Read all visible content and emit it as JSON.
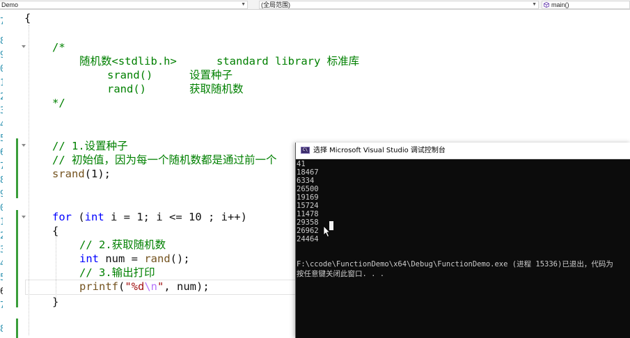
{
  "navbar": {
    "project": "Demo",
    "scope": "(全局范围)",
    "function": "main()"
  },
  "gutter": {
    "line_numbers": [
      "7",
      "8",
      "9",
      "0",
      "1",
      "2",
      "3",
      "4",
      "5",
      "6",
      "7",
      "8",
      "9",
      "0",
      "1",
      "2",
      "3",
      "4",
      "5",
      "6",
      "7",
      "8"
    ],
    "current_index": 19
  },
  "code": {
    "brace_open": "{",
    "comment_start": "/*",
    "comment_l1_a": "随机数<stdlib.h>",
    "comment_l1_b": "standard library 标准库",
    "comment_l2_a": "srand()",
    "comment_l2_b": "设置种子",
    "comment_l3_a": "rand()",
    "comment_l3_b": "获取随机数",
    "comment_end": "*/",
    "c_step1": "// 1.设置种子",
    "c_init": "// 初始值，因为每一个随机数都是通过前一个",
    "srand_fn": "srand",
    "srand_args": "(1);",
    "kw_for": "for",
    "for_a": " (",
    "kw_int": "int",
    "for_b": " i = 1; i <= 10 ; i++)",
    "brace_inner_open": "{",
    "c_step2": "// 2.获取随机数",
    "kw_int2": "int",
    "num_decl": " num = ",
    "rand_fn": "rand",
    "rand_args": "();",
    "c_step3": "// 3.输出打印",
    "printf_fn": "printf",
    "paren_open": "(",
    "str_a": "\"%d",
    "str_esc": "\\n",
    "str_b": "\"",
    "printf_rest": ", num);",
    "brace_inner_close": "}"
  },
  "console": {
    "title": "选择 Microsoft Visual Studio 调试控制台",
    "icon_label": "C\\",
    "output": [
      "41",
      "18467",
      "6334",
      "26500",
      "19169",
      "15724",
      "11478",
      "29358",
      "26962",
      "24464"
    ],
    "exit_msg": "F:\\ccode\\FunctionDemo\\x64\\Debug\\FunctionDemo.exe (进程 15336)已退出，代码为",
    "close_msg": "按任意键关闭此窗口. . ."
  },
  "colors": {
    "comment": "#008000",
    "keyword": "#0000ff",
    "function": "#74531f",
    "string": "#a31515",
    "escape": "#b776fb",
    "line_number": "#2b91af",
    "change_bar": "#3a9d3a",
    "console_bg": "#0c0c0c"
  },
  "icons": [
    "dropdown-arrow-icon",
    "cube-icon",
    "fold-collapse-icon",
    "console-app-icon",
    "mouse-pointer-icon"
  ]
}
